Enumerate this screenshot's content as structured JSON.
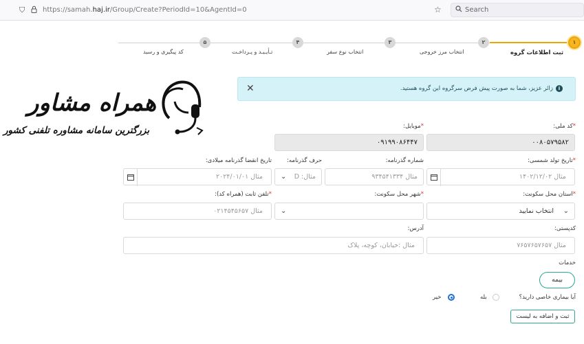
{
  "browser": {
    "url_prefix": "https://samah.",
    "url_domain": "haj.ir",
    "url_path": "/Group/Create?PeriodId=10&AgentId=0",
    "search_placeholder": "Search"
  },
  "stepper": {
    "steps": [
      {
        "num": "۱",
        "label": "ثبت اطلاعات گروه",
        "active": true
      },
      {
        "num": "۲",
        "label": "انتخاب مرز خروجی"
      },
      {
        "num": "۳",
        "label": "انتخاب نوع سفر"
      },
      {
        "num": "۴",
        "label": "تـأیـیـد و پـرداخـت"
      },
      {
        "num": "۵",
        "label": "کد پیگیری و رسید"
      }
    ]
  },
  "alert": {
    "text": "زائر عزیز، شما به صورت پیش فرض سرگروه این گروه هستید.",
    "info_icon": "i",
    "close_icon": "✕"
  },
  "watermark": {
    "title": "همراه مشاور",
    "subtitle": "بزرگترین سامانه مشاوره تلفنی کشور"
  },
  "form": {
    "national_code": {
      "label": "کد ملی:",
      "value": "۰۰۸۰۵۷۹۵۸۲"
    },
    "mobile": {
      "label": "موبایل:",
      "value": "۰۹۱۹۹۰۸۶۴۴۷"
    },
    "birth_date": {
      "label": "تاریخ تولد شمسی:",
      "placeholder": "مثال ۱۴۰۲/۱۲/۰۲"
    },
    "passport_no": {
      "label": "شماره گذرنامه:",
      "placeholder": "مثال ۹۳۴۵۴۱۳۳۴"
    },
    "passport_letter": {
      "label": "حرف گذرنامه:",
      "placeholder": "مثال: D"
    },
    "passport_expiry": {
      "label": "تاریخ انقضا گذرنامه میلادی:",
      "placeholder": "مثال ۲۰۲۴/۰۱/۰۱"
    },
    "province": {
      "label": "استان محل سکونت:",
      "value": "انتخاب نمایید"
    },
    "city": {
      "label": "شهر محل سکونت:"
    },
    "phone": {
      "label": "تلفن ثابت (همراه کد):",
      "placeholder": "مثال ۰۲۱۴۵۴۵۶۵۷"
    },
    "postal_code": {
      "label": "کدپستی:",
      "placeholder": "مثال ۷۶۵۷۶۵۷۶۵۷"
    },
    "address": {
      "label": "آدرس:",
      "placeholder": "مثال :خیابان، کوچه، پلاک"
    },
    "services": {
      "label": "خدمات",
      "button": "بیمه"
    },
    "disease": {
      "label": "آیا بیماری خاصی دارید؟",
      "yes": "بله",
      "no": "خیر"
    },
    "submit": "ثبت و اضافه به لیست"
  }
}
